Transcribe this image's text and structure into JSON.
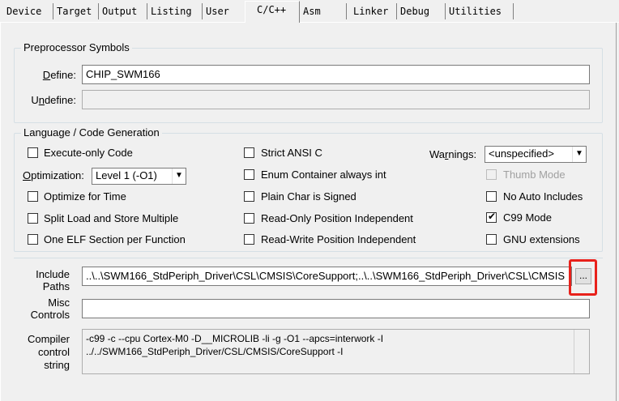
{
  "tabs": [
    {
      "label": "Device"
    },
    {
      "label": "Target"
    },
    {
      "label": "Output"
    },
    {
      "label": "Listing"
    },
    {
      "label": "User"
    },
    {
      "label": "C/C++"
    },
    {
      "label": "Asm"
    },
    {
      "label": "Linker"
    },
    {
      "label": "Debug"
    },
    {
      "label": "Utilities"
    }
  ],
  "active_tab": "C/C++",
  "preprocessor": {
    "title": "Preprocessor Symbols",
    "define_label": "Define:",
    "define_value": "CHIP_SWM166",
    "undefine_label": "Undefine:",
    "undefine_value": ""
  },
  "language": {
    "title": "Language / Code Generation",
    "execute_only": {
      "label": "Execute-only Code",
      "checked": false
    },
    "optimization_label": "Optimization:",
    "optimization_value": "Level 1 (-O1)",
    "optimize_time": {
      "label": "Optimize for Time",
      "checked": false
    },
    "split_load": {
      "label": "Split Load and Store Multiple",
      "checked": false
    },
    "one_elf": {
      "label": "One ELF Section per Function",
      "checked": false
    },
    "strict_ansi": {
      "label": "Strict ANSI C",
      "checked": false
    },
    "enum_container": {
      "label": "Enum Container always int",
      "checked": false
    },
    "plain_char": {
      "label": "Plain Char is Signed",
      "checked": false
    },
    "ro_pi": {
      "label": "Read-Only Position Independent",
      "checked": false
    },
    "rw_pi": {
      "label": "Read-Write Position Independent",
      "checked": false
    },
    "warnings_label": "Warnings:",
    "warnings_value": "<unspecified>",
    "thumb_mode": {
      "label": "Thumb Mode",
      "checked": false,
      "disabled": true
    },
    "no_auto_includes": {
      "label": "No Auto Includes",
      "checked": false
    },
    "c99_mode": {
      "label": "C99 Mode",
      "checked": true
    },
    "gnu_ext": {
      "label": "GNU extensions",
      "checked": false
    }
  },
  "paths": {
    "include_label_1": "Include",
    "include_label_2": "Paths",
    "include_value": "..\\..\\SWM166_StdPeriph_Driver\\CSL\\CMSIS\\CoreSupport;..\\..\\SWM166_StdPeriph_Driver\\CSL\\CMSIS",
    "browse_label": "...",
    "misc_label_1": "Misc",
    "misc_label_2": "Controls",
    "misc_value": "",
    "compiler_label_1": "Compiler",
    "compiler_label_2": "control",
    "compiler_label_3": "string",
    "compiler_line_1": "-c99 -c --cpu Cortex-M0 -D__MICROLIB -li -g -O1 --apcs=interwork -I",
    "compiler_line_2": "../../SWM166_StdPeriph_Driver/CSL/CMSIS/CoreSupport -I"
  },
  "colors": {
    "highlight": "#e8211b",
    "background": "#f0f0f0"
  }
}
